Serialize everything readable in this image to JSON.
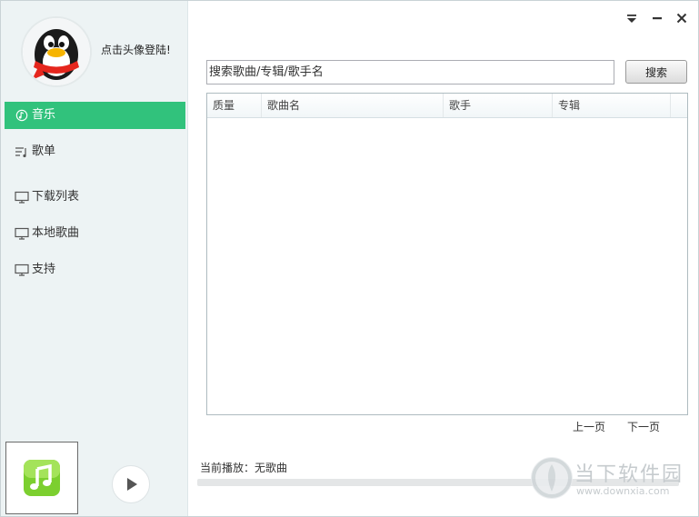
{
  "window": {
    "controls": {
      "menu_icon": "dropdown-menu-icon",
      "minimize_icon": "minimize-icon",
      "close_icon": "close-icon"
    }
  },
  "sidebar": {
    "login_text": "点击头像登陆!",
    "nav": [
      {
        "label": "音乐",
        "icon": "music-icon",
        "active": true
      },
      {
        "label": "歌单",
        "icon": "playlist-icon",
        "active": false
      },
      {
        "label": "下载列表",
        "icon": "monitor-icon",
        "active": false
      },
      {
        "label": "本地歌曲",
        "icon": "monitor-icon",
        "active": false
      },
      {
        "label": "支持",
        "icon": "monitor-icon",
        "active": false
      }
    ],
    "accent_color": "#31c27c"
  },
  "search": {
    "placeholder": "搜索歌曲/专辑/歌手名",
    "button_label": "搜索"
  },
  "results": {
    "columns": [
      "质量",
      "歌曲名",
      "歌手",
      "专辑"
    ],
    "rows": []
  },
  "pager": {
    "prev_label": "上一页",
    "next_label": "下一页"
  },
  "player": {
    "now_playing": "当前播放：无歌曲",
    "progress": 0
  },
  "watermark": {
    "title": "当下软件园",
    "url": "www.downxia.com"
  }
}
